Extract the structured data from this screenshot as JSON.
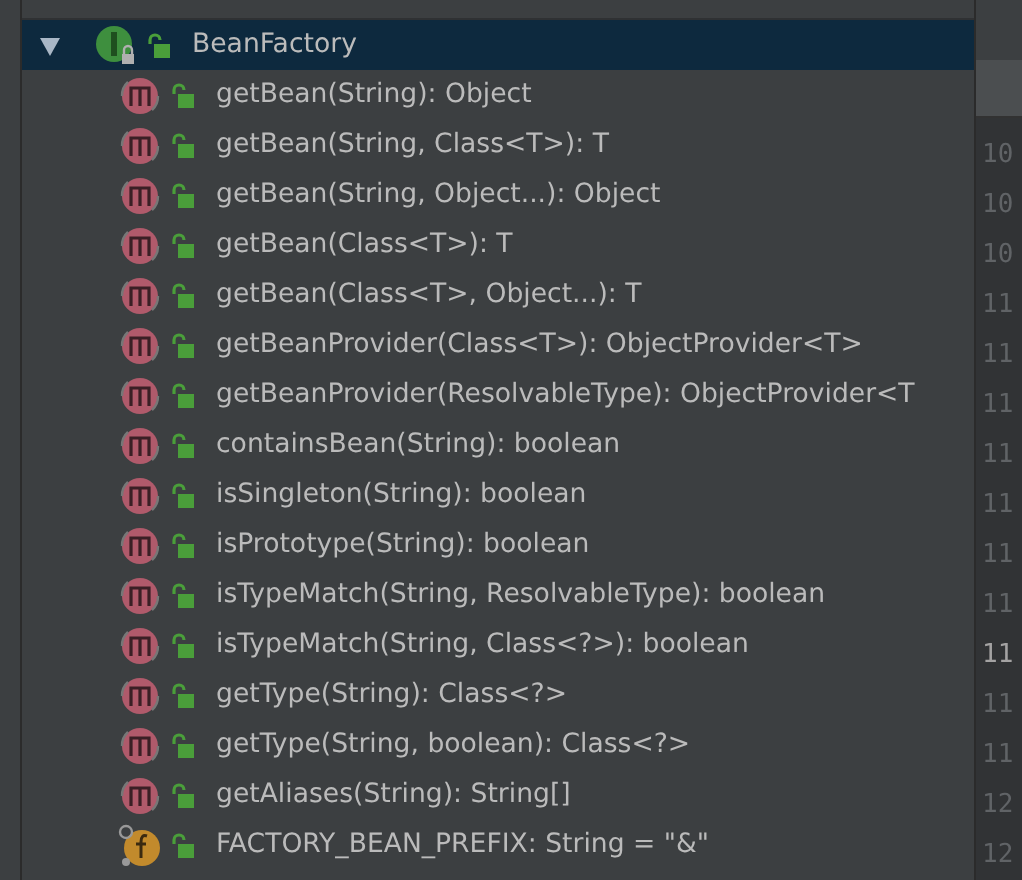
{
  "structure": {
    "root": {
      "name": "BeanFactory",
      "expanded": true,
      "selected": true
    },
    "members": [
      {
        "kind": "method",
        "text": "getBean(String): Object"
      },
      {
        "kind": "method",
        "text": "getBean(String, Class<T>): T"
      },
      {
        "kind": "method",
        "text": "getBean(String, Object...): Object"
      },
      {
        "kind": "method",
        "text": "getBean(Class<T>): T"
      },
      {
        "kind": "method",
        "text": "getBean(Class<T>, Object...): T"
      },
      {
        "kind": "method",
        "text": "getBeanProvider(Class<T>): ObjectProvider<T>"
      },
      {
        "kind": "method",
        "text": "getBeanProvider(ResolvableType): ObjectProvider<T"
      },
      {
        "kind": "method",
        "text": "containsBean(String): boolean"
      },
      {
        "kind": "method",
        "text": "isSingleton(String): boolean"
      },
      {
        "kind": "method",
        "text": "isPrototype(String): boolean"
      },
      {
        "kind": "method",
        "text": "isTypeMatch(String, ResolvableType): boolean"
      },
      {
        "kind": "method",
        "text": "isTypeMatch(String, Class<?>): boolean"
      },
      {
        "kind": "method",
        "text": "getType(String): Class<?>"
      },
      {
        "kind": "method",
        "text": "getType(String, boolean): Class<?>"
      },
      {
        "kind": "method",
        "text": "getAliases(String): String[]"
      },
      {
        "kind": "field",
        "text": "FACTORY_BEAN_PREFIX: String = \"&\""
      }
    ]
  },
  "editor": {
    "line_numbers": [
      {
        "text": "10",
        "current": false
      },
      {
        "text": "10",
        "current": false
      },
      {
        "text": "10",
        "current": false
      },
      {
        "text": "11",
        "current": false
      },
      {
        "text": "11",
        "current": false
      },
      {
        "text": "11",
        "current": false
      },
      {
        "text": "11",
        "current": false
      },
      {
        "text": "11",
        "current": false
      },
      {
        "text": "11",
        "current": false
      },
      {
        "text": "11",
        "current": false
      },
      {
        "text": "11",
        "current": true
      },
      {
        "text": "11",
        "current": false
      },
      {
        "text": "11",
        "current": false
      },
      {
        "text": "12",
        "current": false
      },
      {
        "text": "12",
        "current": false
      }
    ]
  }
}
